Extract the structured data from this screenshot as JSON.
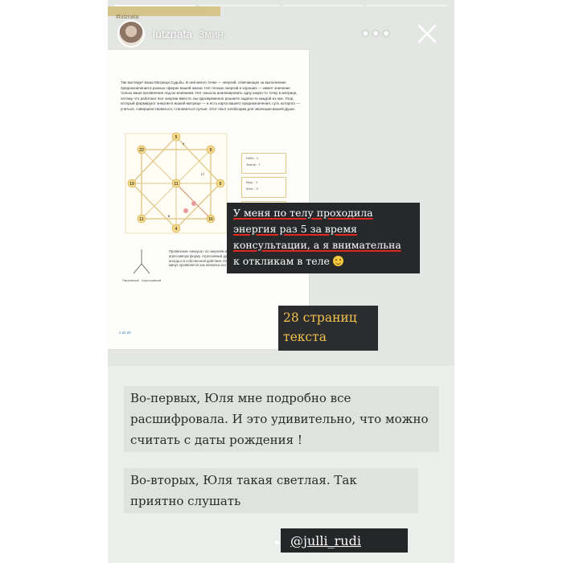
{
  "story": {
    "progress_total": 4,
    "progress_completed": 1,
    "top_tab_text": "#lutznata",
    "user": {
      "username": "lutznata",
      "time_ago": "3мин."
    },
    "more_icon": "more-dots-icon",
    "close_icon": "close-icon"
  },
  "document": {
    "paragraph": "Так выглядит ваша Матрица Судьбы. В ней много точек — энергий, отвечающих за выполнение предназначения в разных сферах вашей жизни. Нет плохих энергий и хороших — имеет значение только ваше проявление под их влиянием. Нет смысла анализировать одну какую-то точку в матрице, потому что работают все энергии вместе, вы одновременно решаете задачи по каждой из них. Узор, который формируют энергии в вашей матрице — и есть карта вашего предназначения, суть которого — учиться, совершенствоваться, становиться лучше. Этот опыт необходим для эволюции вашей Души.",
    "matrix_numbers": [
      "5",
      "22",
      "9",
      "19",
      "11",
      "6",
      "11",
      "4",
      "16",
      "17",
      "8",
      "3"
    ],
    "side_boxes": [
      {
        "line1": "Небо : 1",
        "line2": "Земля : 7"
      },
      {
        "line1": "Муж. : 1",
        "line2": "Жен. : 9"
      },
      {
        "line1": "Дух. : 1",
        "line2": ""
      }
    ],
    "side_text": "Проявление «минуса» по энергиям или агрессивную форму. Агрессивный других людей, в иногда и в собственной действия. Пассивный минус проявляется как нехватка сил и энергии.",
    "passive_label": "Пассивный",
    "aggressive_label": "Агрессивный",
    "footer_left": "2 из 28",
    "footer_right": "Ма"
  },
  "stickers": {
    "energy_line1": "У меня по телу проходила",
    "energy_line2": "энергия раз 5 за время",
    "energy_line3": "консультации, а я внимательна",
    "energy_line4": "к откликам в теле",
    "pages_line1": "28 страниц",
    "pages_line2": "текста",
    "first_text": "Во-первых, Юля мне подробно все расшифровала. И это удивительно, что можно считать с даты рождения !",
    "second_text": "Во-вторых, Юля такая светлая. Так приятно слушать",
    "handle": "@julli_rudi"
  },
  "colors": {
    "story_bg": "#e3e6e2",
    "sticker_dark": "#26282a",
    "underline_red": "#e0281e",
    "pages_yellow": "#f2c14e",
    "matrix_gold": "#e2c88a"
  }
}
